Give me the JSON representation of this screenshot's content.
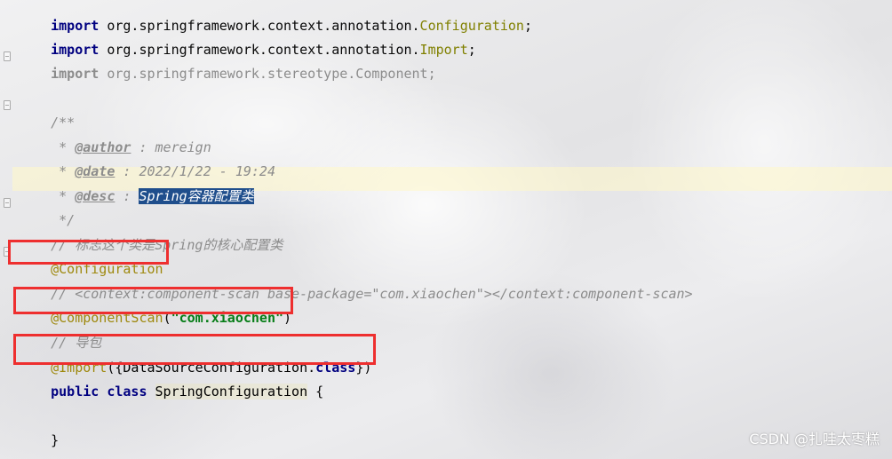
{
  "code": {
    "line1": {
      "keyword": "import",
      "package": " org.springframework.context.annotation.",
      "cls": "Configuration",
      "end": ";"
    },
    "line2": {
      "keyword": "import",
      "package": " org.springframework.context.annotation.",
      "cls": "Import",
      "end": ";"
    },
    "line3": {
      "keyword": "import",
      "rest": " org.springframework.stereotype.Component;"
    },
    "javadoc_open": "/**",
    "author": {
      "star": " * ",
      "tag": "@author",
      "text": " : mereign"
    },
    "date": {
      "star": " * ",
      "tag": "@date",
      "text": " : 2022/1/22 - 19:24"
    },
    "desc": {
      "star": " * ",
      "tag": "@desc",
      "sep": " : ",
      "selected": "Spring容器配置类"
    },
    "javadoc_close": " */",
    "comment1": "// 标志这个类是Spring的核心配置类",
    "annotation_configuration": "@Configuration",
    "comment2": "// <context:component-scan base-package=\"com.xiaochen\"></context:component-scan>",
    "component_scan": {
      "ann": "@ComponentScan",
      "open": "(",
      "arg": "\"com.xiaochen\"",
      "close": ")"
    },
    "comment3": "// 导包",
    "import_ann": {
      "ann": "@Import",
      "open": "({",
      "cls": "DataSourceConfiguration",
      "dot": ".",
      "kw": "class",
      "close": "})"
    },
    "class_decl": {
      "public": "public",
      "class": "class",
      "name": "SpringConfiguration",
      "brace": " {"
    },
    "closing_brace": "}"
  },
  "watermark": "CSDN @扎哇太枣糕",
  "colors": {
    "highlight_box": "#ee2f2f",
    "selection": "#1f4e8c",
    "keyword": "#000080",
    "annotation": "#9e880d",
    "string": "#067d17",
    "comment": "#8c8c8c"
  }
}
